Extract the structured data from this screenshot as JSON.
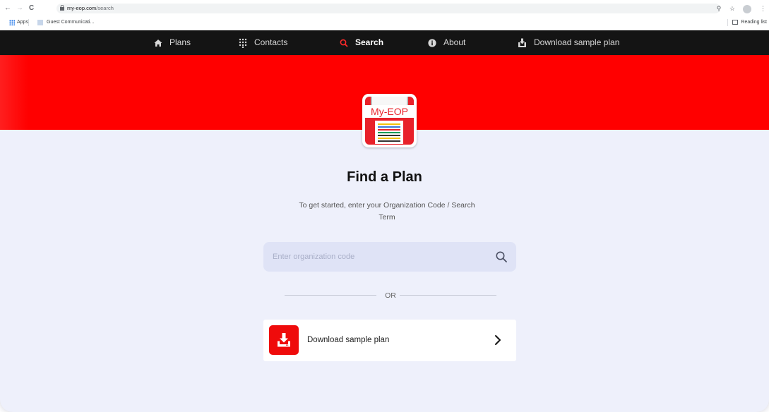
{
  "browser": {
    "url_host": "my-eop.com",
    "url_path": "/search",
    "bookmarks": {
      "apps": "Apps",
      "guest": "Guest Communicati..."
    },
    "reading_list": "Reading list"
  },
  "nav": {
    "items": [
      {
        "label": "Plans",
        "icon": "home-icon"
      },
      {
        "label": "Contacts",
        "icon": "grid-icon"
      },
      {
        "label": "Search",
        "icon": "search-icon",
        "active": true
      },
      {
        "label": "About",
        "icon": "info-icon"
      },
      {
        "label": "Download sample plan",
        "icon": "download-icon"
      }
    ]
  },
  "logo": {
    "text": "My-EOP"
  },
  "main": {
    "title": "Find a Plan",
    "subtitle": "To get started, enter your Organization Code / Search Term",
    "search_placeholder": "Enter organization code",
    "or_text": "OR",
    "download_label": "Download sample plan"
  },
  "colors": {
    "brand_red": "#ff0000",
    "nav_bg": "#141414",
    "page_bg": "#eef0fb",
    "search_bg": "#dfe3f6"
  }
}
